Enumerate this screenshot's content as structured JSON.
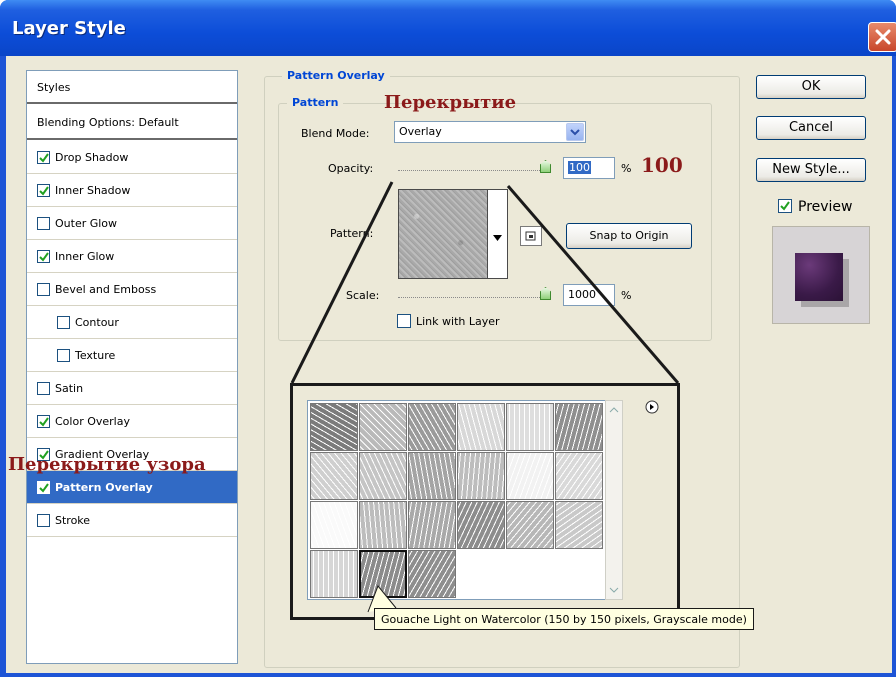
{
  "window": {
    "title": "Layer Style"
  },
  "styles_list": {
    "header": "Styles",
    "blending": "Blending Options: Default",
    "items": [
      {
        "label": "Drop Shadow",
        "checked": true,
        "indent": false
      },
      {
        "label": "Inner Shadow",
        "checked": true,
        "indent": false
      },
      {
        "label": "Outer Glow",
        "checked": false,
        "indent": false
      },
      {
        "label": "Inner Glow",
        "checked": true,
        "indent": false
      },
      {
        "label": "Bevel and Emboss",
        "checked": false,
        "indent": false
      },
      {
        "label": "Contour",
        "checked": false,
        "indent": true
      },
      {
        "label": "Texture",
        "checked": false,
        "indent": true
      },
      {
        "label": "Satin",
        "checked": false,
        "indent": false
      },
      {
        "label": "Color Overlay",
        "checked": true,
        "indent": false
      },
      {
        "label": "Gradient Overlay",
        "checked": true,
        "indent": false
      },
      {
        "label": "Pattern Overlay",
        "checked": true,
        "indent": false,
        "selected": true
      },
      {
        "label": "Stroke",
        "checked": false,
        "indent": false
      }
    ]
  },
  "pattern_overlay": {
    "group_title": "Pattern Overlay",
    "sub_title": "Pattern",
    "blend_mode_label": "Blend Mode:",
    "blend_mode_value": "Overlay",
    "opacity_label": "Opacity:",
    "opacity_value": "100",
    "opacity_unit": "%",
    "pattern_label": "Pattern:",
    "snap_button": "Snap to Origin",
    "scale_label": "Scale:",
    "scale_value": "1000",
    "scale_unit": "%",
    "link_label": "Link with Layer",
    "link_checked": false
  },
  "buttons": {
    "ok": "OK",
    "cancel": "Cancel",
    "new_style": "New Style..."
  },
  "preview": {
    "label": "Preview",
    "checked": true
  },
  "tooltip": "Gouache Light on Watercolor (150 by 150 pixels, Grayscale mode)",
  "annotations": {
    "overlay_ru": "Перекрытие",
    "opacity_ru": "100",
    "pattern_overlay_ru": "Перекрытие узора"
  },
  "colors": {
    "title_bar": "#0a4dd8",
    "selection": "#316ac5",
    "group_title": "#0046d5",
    "annotation": "#8b1a1a"
  }
}
